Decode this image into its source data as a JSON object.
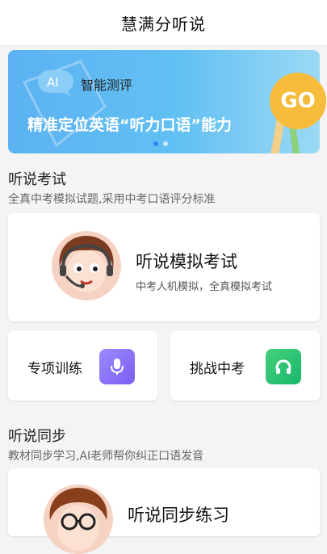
{
  "header": {
    "title": "慧满分听说"
  },
  "banner": {
    "ai": "AI",
    "title": "智能测评",
    "subtitle": "精准定位英语“听力口语”能力",
    "go": "GO"
  },
  "exam_section": {
    "title": "听说考试",
    "subtitle": "全真中考模拟试题,采用中考口语评分标准",
    "card_title": "听说模拟考试",
    "card_subtitle": "中考人机模拟，全真模拟考试"
  },
  "quick": {
    "special_training": "专项训练",
    "challenge": "挑战中考"
  },
  "sync_section": {
    "title": "听说同步",
    "subtitle": "教材同步学习,AI老师帮你纠正口语发音",
    "card_title": "听说同步练习"
  },
  "colors": {
    "accent_blue": "#2e86ff",
    "banner_blue": "#5cb2f2",
    "go_yellow": "#f7bc3c",
    "purple_icon": "#7d5cf2",
    "green_icon": "#18b86b"
  },
  "icons": {
    "ai_bubble": "chat-bubble-icon",
    "mic": "microphone-icon",
    "headphones": "headphones-icon"
  }
}
